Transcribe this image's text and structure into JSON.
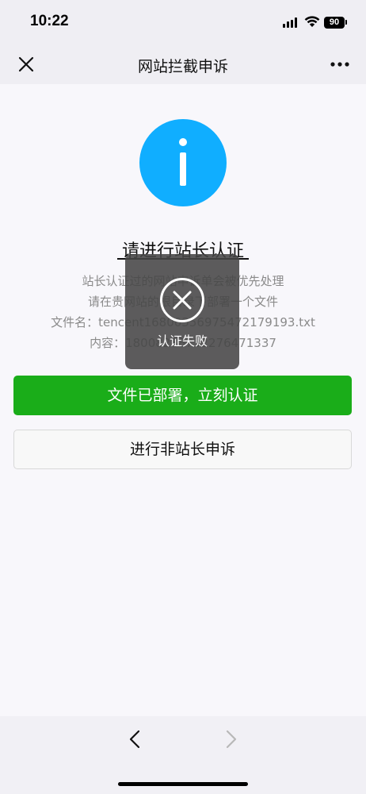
{
  "status_bar": {
    "time": "10:22",
    "battery": "90",
    "icons": [
      "cellular-signal-icon",
      "wifi-icon",
      "battery-icon"
    ]
  },
  "nav": {
    "title": "网站拦截申诉",
    "close_icon": "close-icon",
    "more_icon": "more-icon"
  },
  "main": {
    "icon": "info-icon",
    "icon_color": "#10aeff",
    "heading": "请进行站长认证",
    "desc_line1": "站长认证过的网站申诉单会被优先处理",
    "desc_line2": "请在贵网站的根目录下部署一个文件",
    "file_name_line": "文件名：tencent16800356975472179193.txt",
    "content_line": "内容：18008288732276471337",
    "primary_button": "文件已部署，立刻认证",
    "secondary_button": "进行非站长申诉",
    "primary_color": "#1aad19"
  },
  "toast": {
    "icon": "close-circle-icon",
    "text": "认证失败"
  },
  "bottom_bar": {
    "back_icon": "chevron-left-icon",
    "forward_icon": "chevron-right-icon"
  }
}
